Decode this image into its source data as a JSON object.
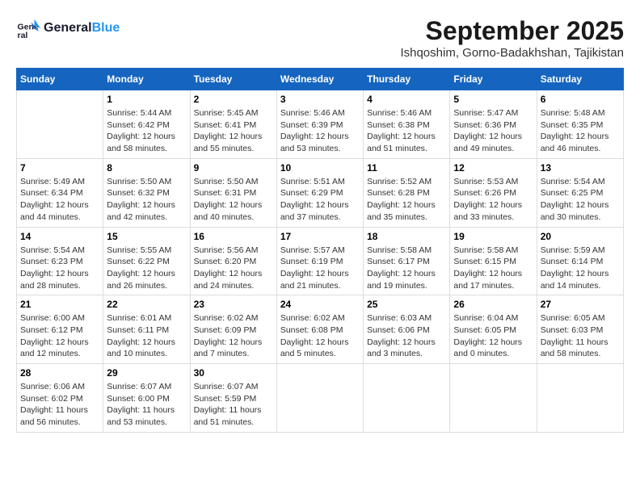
{
  "logo": {
    "line1": "General",
    "line2": "Blue"
  },
  "title": "September 2025",
  "subtitle": "Ishqoshim, Gorno-Badakhshan, Tajikistan",
  "days_of_week": [
    "Sunday",
    "Monday",
    "Tuesday",
    "Wednesday",
    "Thursday",
    "Friday",
    "Saturday"
  ],
  "weeks": [
    [
      {
        "day": "",
        "info": ""
      },
      {
        "day": "1",
        "info": "Sunrise: 5:44 AM\nSunset: 6:42 PM\nDaylight: 12 hours\nand 58 minutes."
      },
      {
        "day": "2",
        "info": "Sunrise: 5:45 AM\nSunset: 6:41 PM\nDaylight: 12 hours\nand 55 minutes."
      },
      {
        "day": "3",
        "info": "Sunrise: 5:46 AM\nSunset: 6:39 PM\nDaylight: 12 hours\nand 53 minutes."
      },
      {
        "day": "4",
        "info": "Sunrise: 5:46 AM\nSunset: 6:38 PM\nDaylight: 12 hours\nand 51 minutes."
      },
      {
        "day": "5",
        "info": "Sunrise: 5:47 AM\nSunset: 6:36 PM\nDaylight: 12 hours\nand 49 minutes."
      },
      {
        "day": "6",
        "info": "Sunrise: 5:48 AM\nSunset: 6:35 PM\nDaylight: 12 hours\nand 46 minutes."
      }
    ],
    [
      {
        "day": "7",
        "info": "Sunrise: 5:49 AM\nSunset: 6:34 PM\nDaylight: 12 hours\nand 44 minutes."
      },
      {
        "day": "8",
        "info": "Sunrise: 5:50 AM\nSunset: 6:32 PM\nDaylight: 12 hours\nand 42 minutes."
      },
      {
        "day": "9",
        "info": "Sunrise: 5:50 AM\nSunset: 6:31 PM\nDaylight: 12 hours\nand 40 minutes."
      },
      {
        "day": "10",
        "info": "Sunrise: 5:51 AM\nSunset: 6:29 PM\nDaylight: 12 hours\nand 37 minutes."
      },
      {
        "day": "11",
        "info": "Sunrise: 5:52 AM\nSunset: 6:28 PM\nDaylight: 12 hours\nand 35 minutes."
      },
      {
        "day": "12",
        "info": "Sunrise: 5:53 AM\nSunset: 6:26 PM\nDaylight: 12 hours\nand 33 minutes."
      },
      {
        "day": "13",
        "info": "Sunrise: 5:54 AM\nSunset: 6:25 PM\nDaylight: 12 hours\nand 30 minutes."
      }
    ],
    [
      {
        "day": "14",
        "info": "Sunrise: 5:54 AM\nSunset: 6:23 PM\nDaylight: 12 hours\nand 28 minutes."
      },
      {
        "day": "15",
        "info": "Sunrise: 5:55 AM\nSunset: 6:22 PM\nDaylight: 12 hours\nand 26 minutes."
      },
      {
        "day": "16",
        "info": "Sunrise: 5:56 AM\nSunset: 6:20 PM\nDaylight: 12 hours\nand 24 minutes."
      },
      {
        "day": "17",
        "info": "Sunrise: 5:57 AM\nSunset: 6:19 PM\nDaylight: 12 hours\nand 21 minutes."
      },
      {
        "day": "18",
        "info": "Sunrise: 5:58 AM\nSunset: 6:17 PM\nDaylight: 12 hours\nand 19 minutes."
      },
      {
        "day": "19",
        "info": "Sunrise: 5:58 AM\nSunset: 6:15 PM\nDaylight: 12 hours\nand 17 minutes."
      },
      {
        "day": "20",
        "info": "Sunrise: 5:59 AM\nSunset: 6:14 PM\nDaylight: 12 hours\nand 14 minutes."
      }
    ],
    [
      {
        "day": "21",
        "info": "Sunrise: 6:00 AM\nSunset: 6:12 PM\nDaylight: 12 hours\nand 12 minutes."
      },
      {
        "day": "22",
        "info": "Sunrise: 6:01 AM\nSunset: 6:11 PM\nDaylight: 12 hours\nand 10 minutes."
      },
      {
        "day": "23",
        "info": "Sunrise: 6:02 AM\nSunset: 6:09 PM\nDaylight: 12 hours\nand 7 minutes."
      },
      {
        "day": "24",
        "info": "Sunrise: 6:02 AM\nSunset: 6:08 PM\nDaylight: 12 hours\nand 5 minutes."
      },
      {
        "day": "25",
        "info": "Sunrise: 6:03 AM\nSunset: 6:06 PM\nDaylight: 12 hours\nand 3 minutes."
      },
      {
        "day": "26",
        "info": "Sunrise: 6:04 AM\nSunset: 6:05 PM\nDaylight: 12 hours\nand 0 minutes."
      },
      {
        "day": "27",
        "info": "Sunrise: 6:05 AM\nSunset: 6:03 PM\nDaylight: 11 hours\nand 58 minutes."
      }
    ],
    [
      {
        "day": "28",
        "info": "Sunrise: 6:06 AM\nSunset: 6:02 PM\nDaylight: 11 hours\nand 56 minutes."
      },
      {
        "day": "29",
        "info": "Sunrise: 6:07 AM\nSunset: 6:00 PM\nDaylight: 11 hours\nand 53 minutes."
      },
      {
        "day": "30",
        "info": "Sunrise: 6:07 AM\nSunset: 5:59 PM\nDaylight: 11 hours\nand 51 minutes."
      },
      {
        "day": "",
        "info": ""
      },
      {
        "day": "",
        "info": ""
      },
      {
        "day": "",
        "info": ""
      },
      {
        "day": "",
        "info": ""
      }
    ]
  ]
}
